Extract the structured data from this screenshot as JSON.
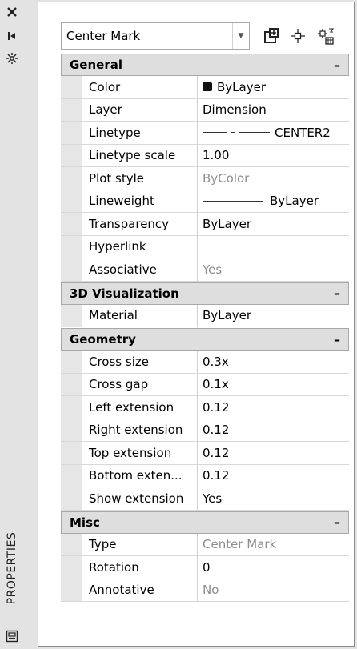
{
  "palette_strip": {
    "title": "PROPERTIES",
    "icons": [
      "close-icon",
      "autohide-icon",
      "settings-icon",
      "properties-panel-icon"
    ]
  },
  "toolbar": {
    "selected_object": "Center Mark",
    "buttons": [
      "toggle-pickadd-icon",
      "select-objects-icon",
      "quick-select-icon"
    ]
  },
  "categories": [
    {
      "title": "General",
      "collapse": "–",
      "rows": [
        {
          "name": "Color",
          "value": "ByLayer",
          "readonly": false
        },
        {
          "name": "Layer",
          "value": "Dimension",
          "readonly": false
        },
        {
          "name": "Linetype",
          "value": "CENTER2",
          "readonly": false
        },
        {
          "name": "Linetype scale",
          "value": "1.00",
          "readonly": false
        },
        {
          "name": "Plot style",
          "value": "ByColor",
          "readonly": true
        },
        {
          "name": "Lineweight",
          "value": "ByLayer",
          "readonly": false
        },
        {
          "name": "Transparency",
          "value": "ByLayer",
          "readonly": false
        },
        {
          "name": "Hyperlink",
          "value": "",
          "readonly": false
        },
        {
          "name": "Associative",
          "value": "Yes",
          "readonly": true
        }
      ]
    },
    {
      "title": "3D Visualization",
      "collapse": "–",
      "rows": [
        {
          "name": "Material",
          "value": "ByLayer",
          "readonly": false
        }
      ]
    },
    {
      "title": "Geometry",
      "collapse": "–",
      "rows": [
        {
          "name": "Cross size",
          "value": "0.3x",
          "readonly": false
        },
        {
          "name": "Cross gap",
          "value": "0.1x",
          "readonly": false
        },
        {
          "name": "Left extension",
          "value": "0.12",
          "readonly": false
        },
        {
          "name": "Right extension",
          "value": "0.12",
          "readonly": false
        },
        {
          "name": "Top extension",
          "value": "0.12",
          "readonly": false
        },
        {
          "name": "Bottom exten...",
          "value": "0.12",
          "readonly": false
        },
        {
          "name": "Show extension",
          "value": "Yes",
          "readonly": false
        }
      ]
    },
    {
      "title": "Misc",
      "collapse": "–",
      "rows": [
        {
          "name": "Type",
          "value": "Center Mark",
          "readonly": true
        },
        {
          "name": "Rotation",
          "value": "0",
          "readonly": false
        },
        {
          "name": "Annotative",
          "value": "No",
          "readonly": true
        }
      ]
    }
  ]
}
